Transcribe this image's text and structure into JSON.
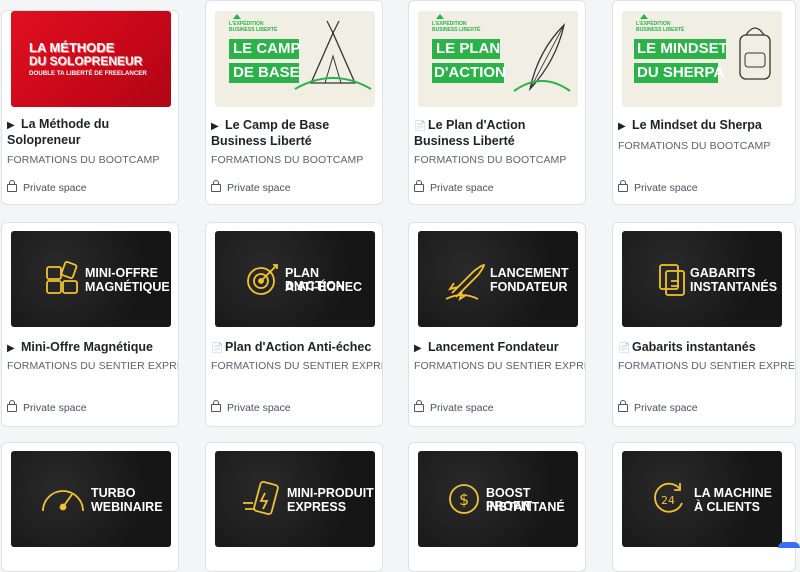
{
  "colors": {
    "accent_green": "#2bb34a",
    "accent_red": "#e0101f",
    "gold": "#f3c22f"
  },
  "cards": [
    {
      "thumb": {
        "style": "red",
        "line1": "LA MÉTHODE",
        "line2": "DU SOLOPRENEUR",
        "line3": "DOUBLE TA LIBERTÉ DE FREELANCER"
      },
      "icon": "play-icon",
      "icon_glyph": "▶",
      "title": "La Méthode du Solopreneur",
      "category": "FORMATIONS DU BOOTCAMP",
      "privacy": "Private space"
    },
    {
      "thumb": {
        "style": "cream",
        "brand1": "L'EXPÉDITION",
        "brand2": "BUSINESS LIBERTÉ",
        "line1": "LE CAMP",
        "line2": "DE BASE",
        "art": "tent"
      },
      "icon": "play-icon",
      "icon_glyph": "▶",
      "title": "Le Camp de Base Business Liberté",
      "category": "FORMATIONS DU BOOTCAMP",
      "privacy": "Private space"
    },
    {
      "thumb": {
        "style": "cream",
        "brand1": "L'EXPÉDITION",
        "brand2": "BUSINESS LIBERTÉ",
        "line1": "LE PLAN",
        "line2": "D'ACTION",
        "art": "feather"
      },
      "icon": "document-icon",
      "icon_glyph": "📄",
      "title": "Le Plan d'Action Business Liberté",
      "category": "FORMATIONS DU BOOTCAMP",
      "privacy": "Private space"
    },
    {
      "thumb": {
        "style": "cream",
        "brand1": "L'EXPÉDITION",
        "brand2": "BUSINESS LIBERTÉ",
        "line1": "LE MINDSET",
        "line2": "DU SHERPA",
        "art": "backpack"
      },
      "icon": "play-icon",
      "icon_glyph": "▶",
      "title": "Le Mindset du Sherpa",
      "category": "FORMATIONS DU BOOTCAMP",
      "privacy": "Private space"
    },
    {
      "thumb": {
        "style": "dark",
        "line1": "MINI-OFFRE",
        "line2": "MAGNÉTIQUE",
        "art": "blocks"
      },
      "icon": "play-icon",
      "icon_glyph": "▶",
      "title": "Mini-Offre Magnétique",
      "category": "FORMATIONS DU SENTIER EXPRESS",
      "privacy": "Private space"
    },
    {
      "thumb": {
        "style": "dark",
        "line1": "PLAN D'ACTION",
        "line2": "ANTI-ÉCHEC",
        "art": "target"
      },
      "icon": "document-icon",
      "icon_glyph": "📄",
      "title": "Plan d'Action Anti-échec",
      "category": "FORMATIONS DU SENTIER EXPRESS",
      "privacy": "Private space"
    },
    {
      "thumb": {
        "style": "dark",
        "line1": "LANCEMENT",
        "line2": "FONDATEUR",
        "art": "rocket"
      },
      "icon": "play-icon",
      "icon_glyph": "▶",
      "title": "Lancement Fondateur",
      "category": "FORMATIONS DU SENTIER EXPRESS",
      "privacy": "Private space"
    },
    {
      "thumb": {
        "style": "dark",
        "line1": "GABARITS",
        "line2": "INSTANTANÉS",
        "art": "files"
      },
      "icon": "document-icon",
      "icon_glyph": "📄",
      "title": "Gabarits instantanés",
      "category": "FORMATIONS DU SENTIER EXPRESS",
      "privacy": "Private space"
    },
    {
      "thumb": {
        "style": "dark",
        "line1": "TURBO",
        "line2": "WEBINAIRE",
        "art": "gauge"
      }
    },
    {
      "thumb": {
        "style": "dark",
        "line1": "MINI-PRODUIT",
        "line2": "EXPRESS",
        "art": "phone"
      }
    },
    {
      "thumb": {
        "style": "dark",
        "line1": "BOOST PROFIT",
        "line2": "INSTANTANÉ",
        "art": "coin"
      }
    },
    {
      "thumb": {
        "style": "dark",
        "line1": "LA MACHINE",
        "line2": "À CLIENTS",
        "art": "clock24"
      }
    }
  ]
}
